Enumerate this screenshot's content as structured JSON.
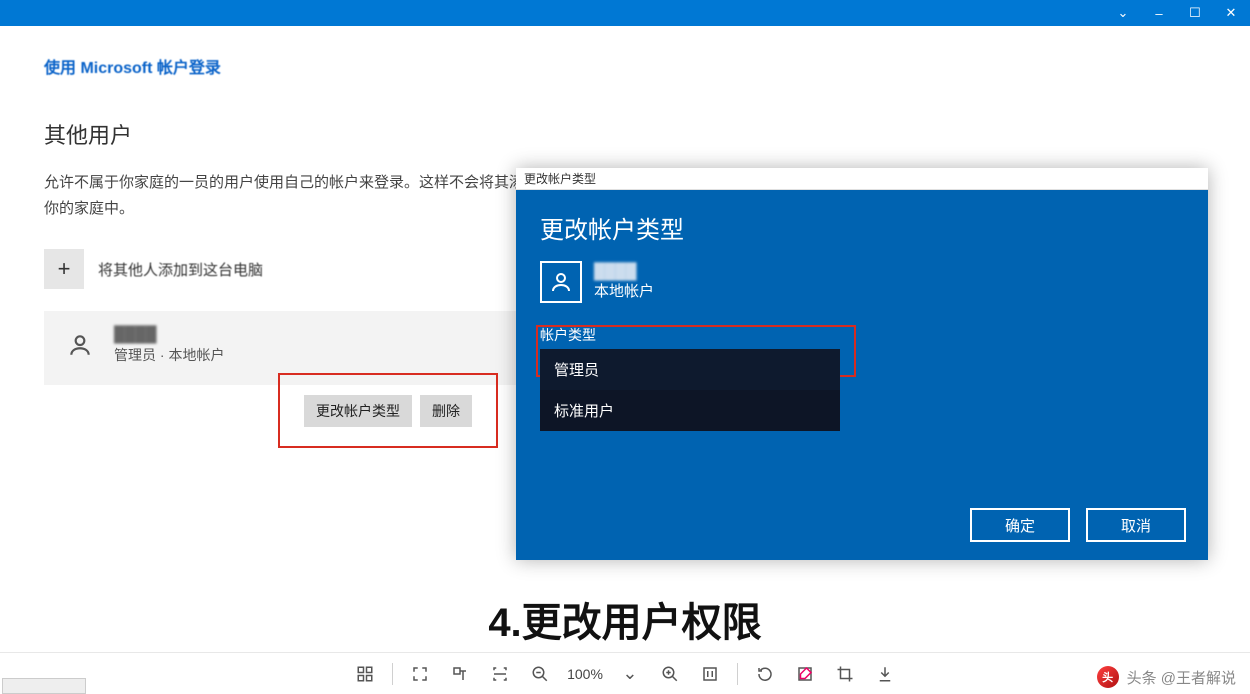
{
  "titlebar": {
    "min": "–",
    "max": "☐",
    "close": "✕",
    "dropdown": "⌄"
  },
  "main": {
    "microsoft_link": "使用 Microsoft 帐户登录",
    "section_title": "其他用户",
    "section_desc": "允许不属于你家庭的一员的用户使用自己的帐户来登录。这样不会将其添加到你的家庭中。",
    "add_label": "将其他人添加到这台电脑",
    "plus": "+",
    "user_role": "管理员 · 本地帐户",
    "btn_change": "更改帐户类型",
    "btn_delete": "删除"
  },
  "dialog": {
    "window_title": "更改帐户类型",
    "heading": "更改帐户类型",
    "user_type": "本地帐户",
    "type_label": "帐户类型",
    "option_admin": "管理员",
    "option_standard": "标准用户",
    "ok": "确定",
    "cancel": "取消"
  },
  "caption": "4.更改用户权限",
  "toolbar": {
    "zoom": "100%"
  },
  "watermark": {
    "text": "头条 @王者解说",
    "logo": "头"
  }
}
